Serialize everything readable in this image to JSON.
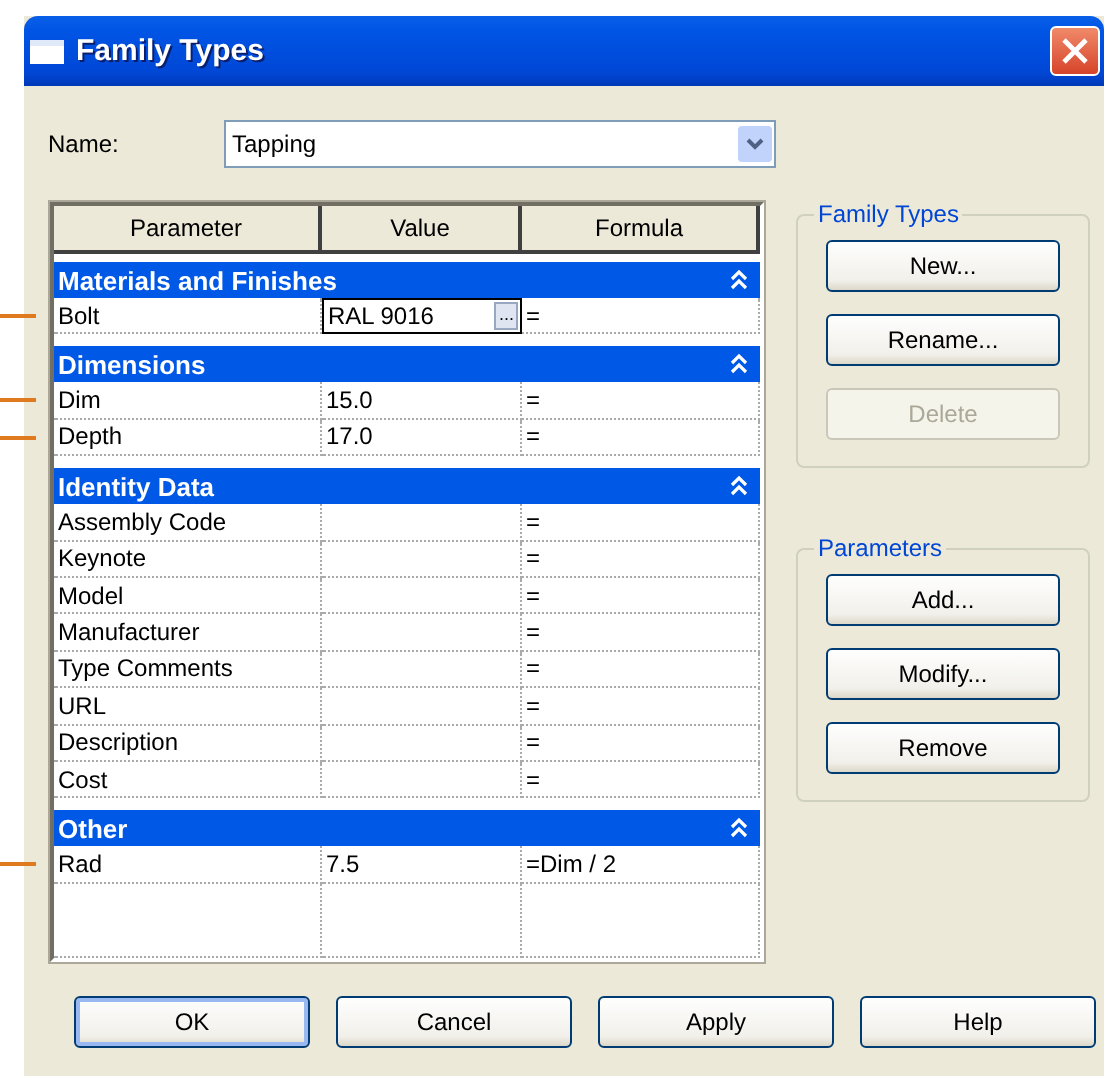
{
  "window": {
    "title": "Family Types"
  },
  "name_field": {
    "label": "Name:",
    "value": "Tapping"
  },
  "grid": {
    "columns": [
      "Parameter",
      "Value",
      "Formula"
    ],
    "rows": [
      {
        "kind": "section",
        "label": "Materials and Finishes",
        "expanded": true
      },
      {
        "kind": "param",
        "parameter": "Bolt",
        "value": "RAL 9016",
        "browse": "...",
        "formula": "=",
        "editing": true,
        "annotated": true
      },
      {
        "kind": "section",
        "label": "Dimensions",
        "expanded": true
      },
      {
        "kind": "param",
        "parameter": "Dim",
        "value": "15.0",
        "formula": "=",
        "editing": false,
        "annotated": true
      },
      {
        "kind": "param",
        "parameter": "Depth",
        "value": "17.0",
        "formula": "=",
        "editing": false,
        "annotated": true
      },
      {
        "kind": "section",
        "label": "Identity Data",
        "expanded": true
      },
      {
        "kind": "param",
        "parameter": "Assembly Code",
        "formula": "=",
        "editing": false,
        "annotated": false
      },
      {
        "kind": "param",
        "parameter": "Keynote",
        "formula": "=",
        "editing": false,
        "annotated": false
      },
      {
        "kind": "param",
        "parameter": "Model",
        "formula": "=",
        "editing": false,
        "annotated": false
      },
      {
        "kind": "param",
        "parameter": "Manufacturer",
        "formula": "=",
        "editing": false,
        "annotated": false
      },
      {
        "kind": "param",
        "parameter": "Type Comments",
        "formula": "=",
        "editing": false,
        "annotated": false
      },
      {
        "kind": "param",
        "parameter": "URL",
        "formula": "=",
        "editing": false,
        "annotated": false
      },
      {
        "kind": "param",
        "parameter": "Description",
        "formula": "=",
        "editing": false,
        "annotated": false
      },
      {
        "kind": "param",
        "parameter": "Cost",
        "formula": "=",
        "editing": false,
        "annotated": false
      },
      {
        "kind": "section",
        "label": "Other",
        "expanded": true
      },
      {
        "kind": "param",
        "parameter": "Rad",
        "value": "7.5",
        "formula": "=Dim / 2",
        "editing": false,
        "annotated": true
      }
    ]
  },
  "groups": [
    {
      "title": "Family Types",
      "buttons": [
        {
          "label": "New...",
          "disabled": false
        },
        {
          "label": "Rename...",
          "disabled": false
        },
        {
          "label": "Delete",
          "disabled": true
        }
      ]
    },
    {
      "title": "Parameters",
      "buttons": [
        {
          "label": "Add...",
          "disabled": false
        },
        {
          "label": "Modify...",
          "disabled": false
        },
        {
          "label": "Remove",
          "disabled": false
        }
      ]
    }
  ],
  "buttons": [
    {
      "label": "OK",
      "default": true
    },
    {
      "label": "Cancel",
      "default": false
    },
    {
      "label": "Apply",
      "default": false
    },
    {
      "label": "Help",
      "default": false
    }
  ]
}
